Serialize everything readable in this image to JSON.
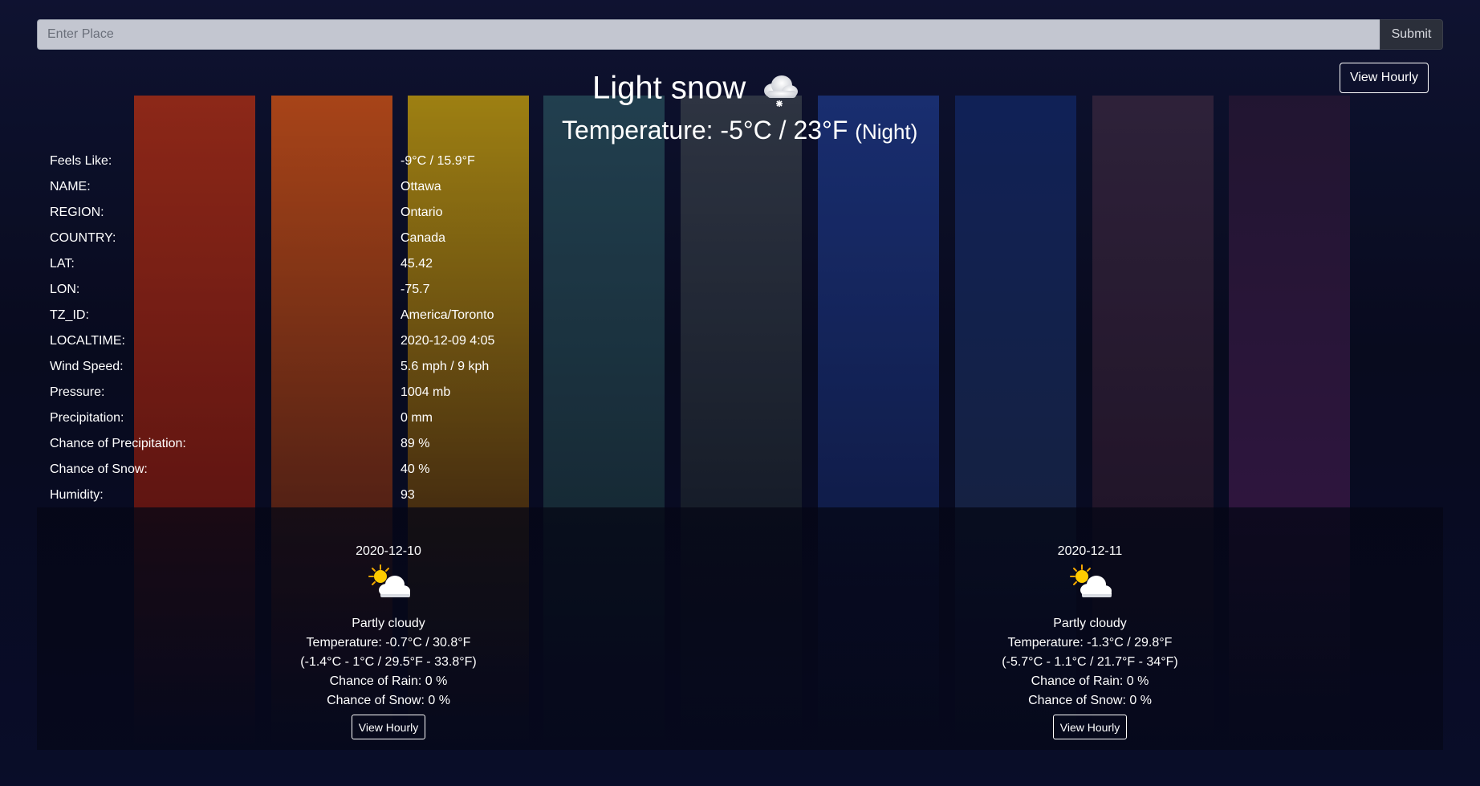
{
  "search": {
    "placeholder": "Enter Place",
    "value": "",
    "submit_label": "Submit"
  },
  "current": {
    "view_hourly_label": "View Hourly",
    "condition": "Light snow",
    "condition_icon": "light-snow-cloud-icon",
    "temperature": "Temperature: -5°C / 23°F",
    "period": "(Night)"
  },
  "details": [
    {
      "label": "Feels Like:",
      "value": "-9°C / 15.9°F"
    },
    {
      "label": "NAME:",
      "value": "Ottawa"
    },
    {
      "label": "REGION:",
      "value": "Ontario"
    },
    {
      "label": "COUNTRY:",
      "value": "Canada"
    },
    {
      "label": "LAT:",
      "value": "45.42"
    },
    {
      "label": "LON:",
      "value": "-75.7"
    },
    {
      "label": "TZ_ID:",
      "value": "America/Toronto"
    },
    {
      "label": "LOCALTIME:",
      "value": "2020-12-09 4:05"
    },
    {
      "label": "Wind Speed:",
      "value": "5.6 mph / 9 kph"
    },
    {
      "label": "Pressure:",
      "value": "1004 mb"
    },
    {
      "label": "Precipitation:",
      "value": "0 mm"
    },
    {
      "label": "Chance of Precipitation:",
      "value": "89 %"
    },
    {
      "label": "Chance of Snow:",
      "value": "40 %"
    },
    {
      "label": "Humidity:",
      "value": "93"
    }
  ],
  "forecast": [
    {
      "date": "2020-12-10",
      "icon": "partly-cloudy-icon",
      "condition": "Partly cloudy",
      "temperature": "Temperature: -0.7°C / 30.8°F",
      "range": "(-1.4°C - 1°C / 29.5°F - 33.8°F)",
      "rain": "Chance of Rain: 0 %",
      "snow": "Chance of Snow: 0 %",
      "button": "View Hourly"
    },
    {
      "date": "2020-12-11",
      "icon": "partly-cloudy-icon",
      "condition": "Partly cloudy",
      "temperature": "Temperature: -1.3°C / 29.8°F",
      "range": "(-5.7°C - 1.1°C / 21.7°F - 34°F)",
      "rain": "Chance of Rain: 0 %",
      "snow": "Chance of Snow: 0 %",
      "button": "View Hourly"
    }
  ],
  "background_strip_colors": [
    [
      "#b3321a",
      "#7a1a12"
    ],
    [
      "#d6561a",
      "#6b2a16"
    ],
    [
      "#c9a312",
      "#5a3a10"
    ],
    [
      "#2a5060",
      "#1c3540"
    ],
    [
      "#3a4250",
      "#1c2430"
    ],
    [
      "#1f3a8a",
      "#14245a"
    ],
    [
      "#142a6a",
      "#1a2a50"
    ],
    [
      "#3a2a45",
      "#2a1a30"
    ],
    [
      "#2a1a3a",
      "#3a1a4a"
    ]
  ]
}
